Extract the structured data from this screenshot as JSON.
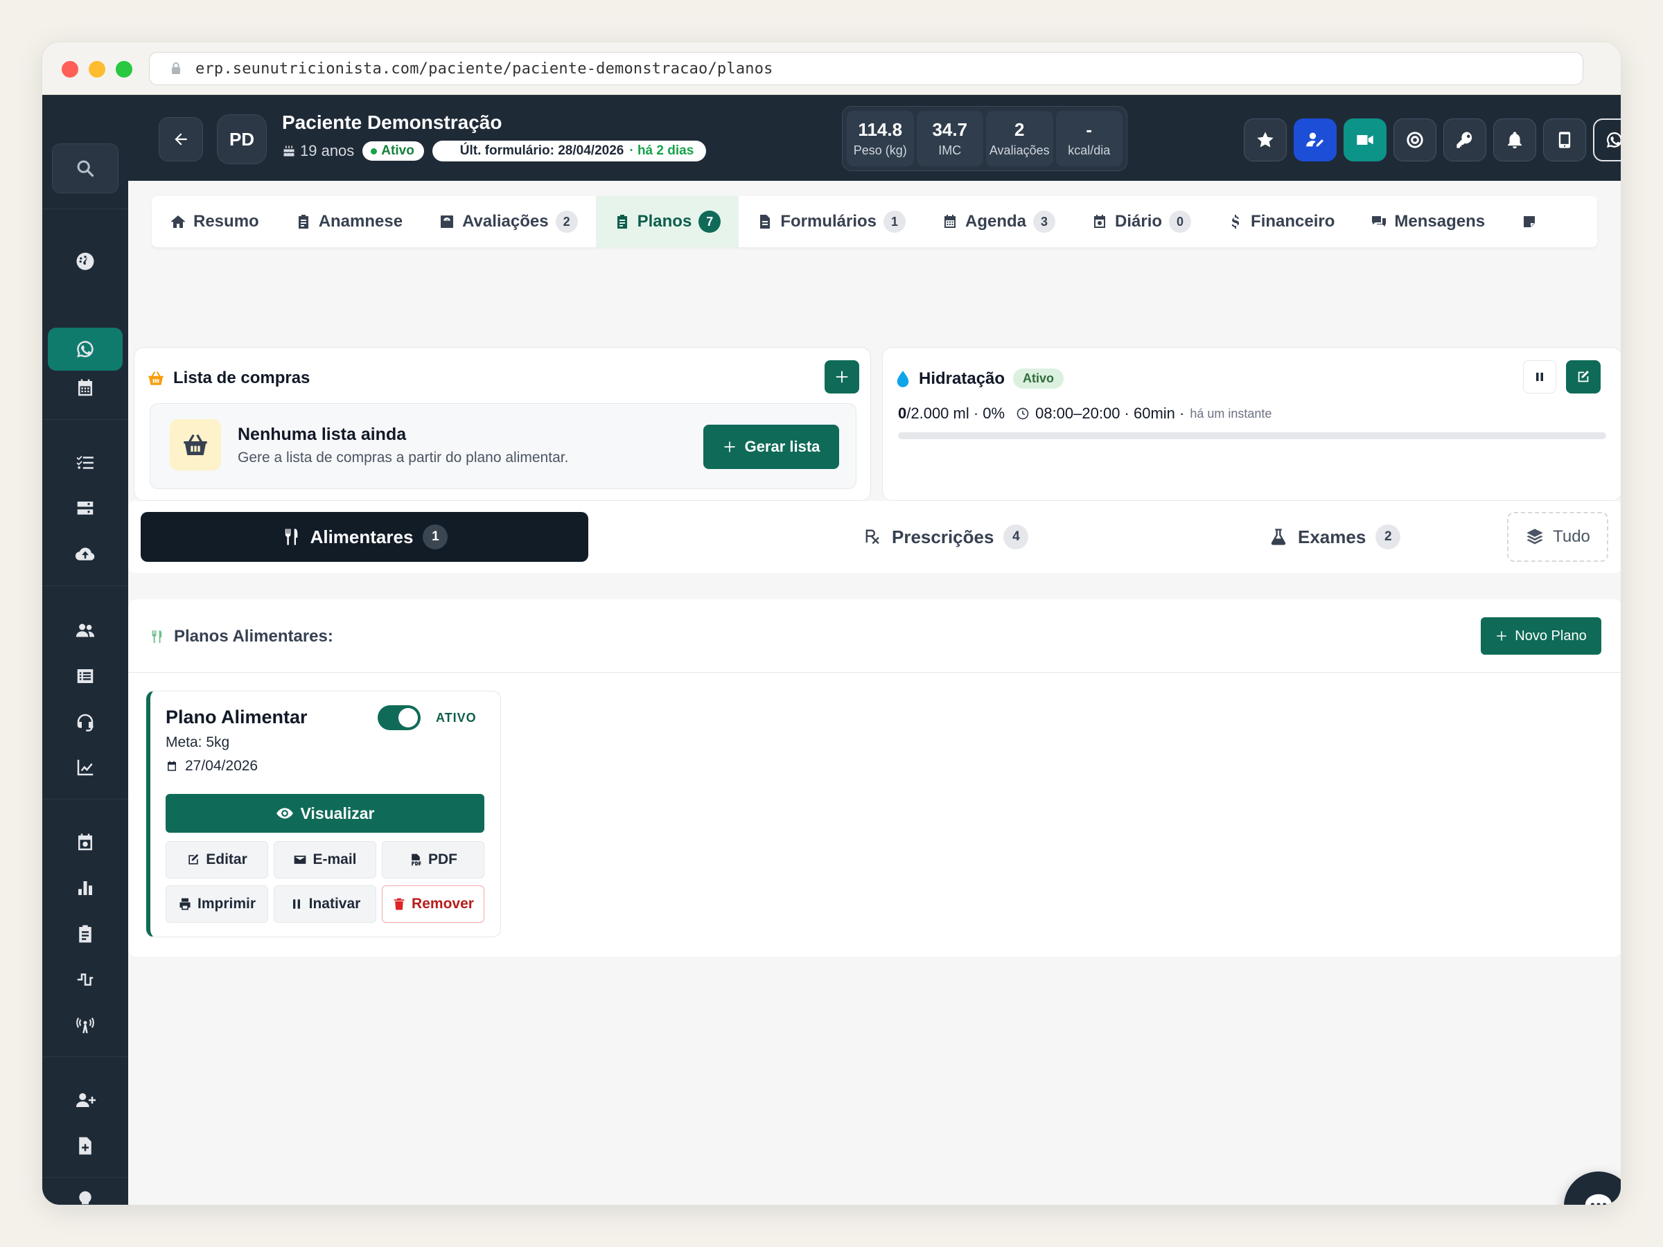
{
  "browser": {
    "url": "erp.seunutricionista.com/paciente/paciente-demonstracao/planos"
  },
  "patient": {
    "initials": "PD",
    "name": "Paciente Demonstração",
    "age": "19 anos",
    "status": "Ativo",
    "last_form": "Últ. formulário: 28/04/2026",
    "last_form_ago": "· há 2 dias"
  },
  "stats": [
    {
      "value": "114.8",
      "label": "Peso (kg)"
    },
    {
      "value": "34.7",
      "label": "IMC"
    },
    {
      "value": "2",
      "label": "Avaliações"
    },
    {
      "value": "-",
      "label": "kcal/dia"
    }
  ],
  "tabs": [
    {
      "label": "Resumo",
      "count": ""
    },
    {
      "label": "Anamnese",
      "count": ""
    },
    {
      "label": "Avaliações",
      "count": "2"
    },
    {
      "label": "Planos",
      "count": "7"
    },
    {
      "label": "Formulários",
      "count": "1"
    },
    {
      "label": "Agenda",
      "count": "3"
    },
    {
      "label": "Diário",
      "count": "0"
    },
    {
      "label": "Financeiro",
      "count": ""
    },
    {
      "label": "Mensagens",
      "count": ""
    }
  ],
  "shopping": {
    "title": "Lista de compras",
    "empty_title": "Nenhuma lista ainda",
    "empty_subtitle": "Gere a lista de compras a partir do plano alimentar.",
    "generate_label": "Gerar lista"
  },
  "hydration": {
    "title": "Hidratação",
    "status": "Ativo",
    "amount_bold": "0",
    "amount_rest": "/2.000 ml · 0%",
    "schedule": "08:00–20:00 · 60min ·",
    "updated": "há um instante",
    "progress": 0
  },
  "segments": [
    {
      "label": "Alimentares",
      "count": "1"
    },
    {
      "label": "Prescrições",
      "count": "4"
    },
    {
      "label": "Exames",
      "count": "2"
    }
  ],
  "segment_all": "Tudo",
  "plans": {
    "section_title": "Planos Alimentares:",
    "new_label": "Novo Plano",
    "items": [
      {
        "name": "Plano Alimentar",
        "status": "ATIVO",
        "goal": "Meta: 5kg",
        "date": "27/04/2026",
        "view_label": "Visualizar",
        "edit_label": "Editar",
        "email_label": "E-mail",
        "pdf_label": "PDF",
        "print_label": "Imprimir",
        "deactivate_label": "Inativar",
        "remove_label": "Remover"
      }
    ]
  },
  "colors": {
    "primary": "#0f6b58",
    "sidebar": "#1f2a37",
    "accent_blue": "#1d4ed8",
    "accent_teal": "#0d9488",
    "danger": "#dc2626"
  }
}
